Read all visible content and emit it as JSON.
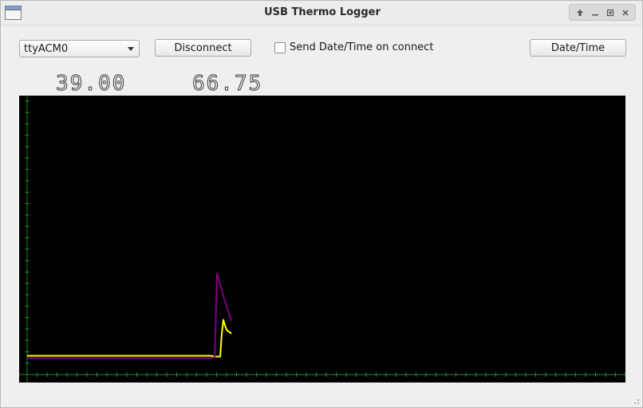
{
  "window": {
    "title": "USB Thermo Logger",
    "buttons": [
      "restore-up",
      "minimize",
      "maximize",
      "close"
    ]
  },
  "toolbar": {
    "port_select": {
      "value": "ttyACM0"
    },
    "disconnect_label": "Disconnect",
    "send_datetime_checkbox": {
      "label": "Send Date/Time on connect",
      "checked": false
    },
    "datetime_label": "Date/Time"
  },
  "readouts": {
    "temp1": "39.00",
    "temp2": "66.75"
  },
  "colors": {
    "plot_background": "#000000",
    "axis": "#1f8a1f",
    "series_1": "#ffff00",
    "series_2": "#800080"
  },
  "chart_data": {
    "type": "line",
    "title": "",
    "xlabel": "",
    "ylabel": "",
    "grid": false,
    "series": [
      {
        "color": "#ffff00",
        "points": [
          [
            0,
            23
          ],
          [
            230,
            23
          ],
          [
            236,
            22
          ],
          [
            242,
            22
          ],
          [
            244,
            50
          ],
          [
            246,
            67
          ],
          [
            248,
            60
          ],
          [
            250,
            55
          ],
          [
            252,
            53
          ],
          [
            254,
            52
          ],
          [
            256,
            50
          ]
        ]
      },
      {
        "color": "#800080",
        "points": [
          [
            0,
            20
          ],
          [
            230,
            20
          ],
          [
            235,
            21
          ],
          [
            236,
            50
          ],
          [
            237,
            90
          ],
          [
            238,
            124
          ],
          [
            240,
            118
          ],
          [
            242,
            111
          ],
          [
            244,
            104
          ],
          [
            246,
            96
          ],
          [
            248,
            90
          ],
          [
            250,
            84
          ],
          [
            252,
            78
          ],
          [
            254,
            72
          ],
          [
            256,
            66
          ]
        ]
      }
    ],
    "xlim": [
      0,
      748
    ],
    "ylim": [
      0,
      340
    ]
  }
}
